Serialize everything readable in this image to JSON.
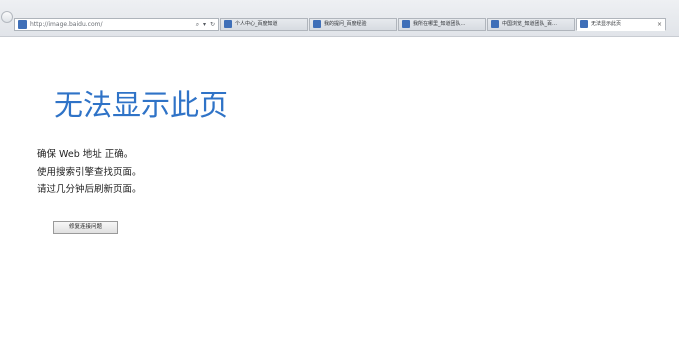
{
  "browser": {
    "address": {
      "url": "http://image.baidu.com/",
      "search_glyph": "⌕",
      "dropdown_glyph": "▾",
      "refresh_glyph": "↻"
    },
    "tabs": [
      {
        "label": "个人中心_百度知道",
        "active": false
      },
      {
        "label": "我的提问_百度经验",
        "active": false
      },
      {
        "label": "我所在哪里_知道团队…",
        "active": false
      },
      {
        "label": "中国浏览_知道团队_百…",
        "active": false
      },
      {
        "label": "无法显示此页",
        "active": true,
        "close_glyph": "×"
      }
    ]
  },
  "error_page": {
    "title": "无法显示此页",
    "lines": [
      "确保 Web 地址 正确。",
      "使用搜索引擎查找页面。",
      "请过几分钟后刷新页面。"
    ],
    "fix_button_label": "修复连接问题"
  },
  "colors": {
    "title": "#2f73c7",
    "favicon": "#3f6fb8"
  }
}
